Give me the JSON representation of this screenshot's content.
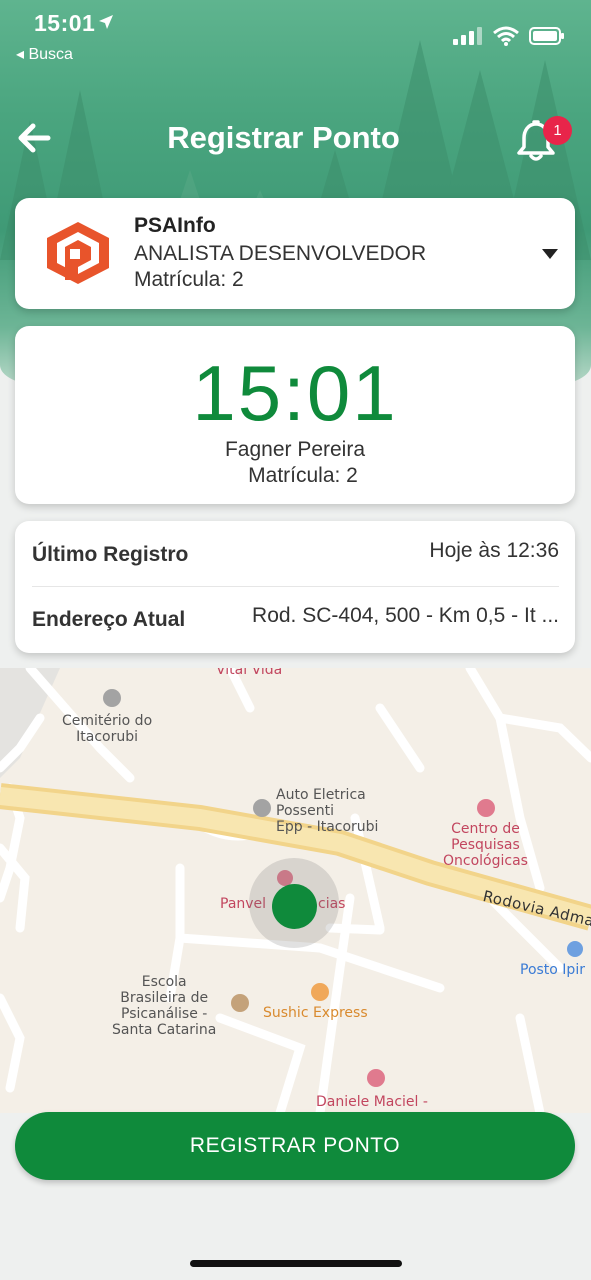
{
  "status_bar": {
    "time": "15:01",
    "back_app": "◂ Busca",
    "location_icon": "location-arrow-icon",
    "signal_icon": "cellular-signal-icon",
    "wifi_icon": "wifi-icon",
    "battery_icon": "battery-icon"
  },
  "nav": {
    "title": "Registrar Ponto",
    "back_icon": "arrow-left-icon",
    "bell_icon": "bell-icon",
    "notification_count": "1"
  },
  "company": {
    "name": "PSAInfo",
    "role": "ANALISTA DESENVOLVEDOR",
    "registration": "Matrícula: 2",
    "logo_icon": "psainfo-logo-icon",
    "dropdown_icon": "caret-down-icon"
  },
  "clock": {
    "time": "15:01",
    "employee_name": "Fagner Pereira",
    "registration": "Matrícula: 2"
  },
  "info": {
    "last_record_label": "Último Registro",
    "last_record_value": "Hoje às 12:36",
    "address_label": "Endereço Atual",
    "address_value": "Rod. SC-404, 500 - Km 0,5 - It ..."
  },
  "map": {
    "labels": {
      "vital": "Vital Vida",
      "cemetery": "Cemitério do\nItacorubi",
      "auto": "Auto Eletrica\nPossenti\nEpp - Itacorubi",
      "centro": "Centro de\nPesquisas\nOncológicas",
      "road": "Rodovia Adma",
      "panvel_left": "Panvel",
      "panvel_right": "cias",
      "posto": "Posto Ipir",
      "escola": "Escola\nBrasileira de\nPsicanálise -\nSanta Catarina",
      "sushic": "Sushic Express",
      "daniele": "Daniele Maciel -"
    },
    "colors": {
      "user_location": "#0f8a3b"
    }
  },
  "actions": {
    "register_label": "REGISTRAR PONTO"
  },
  "colors": {
    "accent": "#0f8a3b",
    "badge": "#e8254a",
    "logo": "#e8542b"
  }
}
